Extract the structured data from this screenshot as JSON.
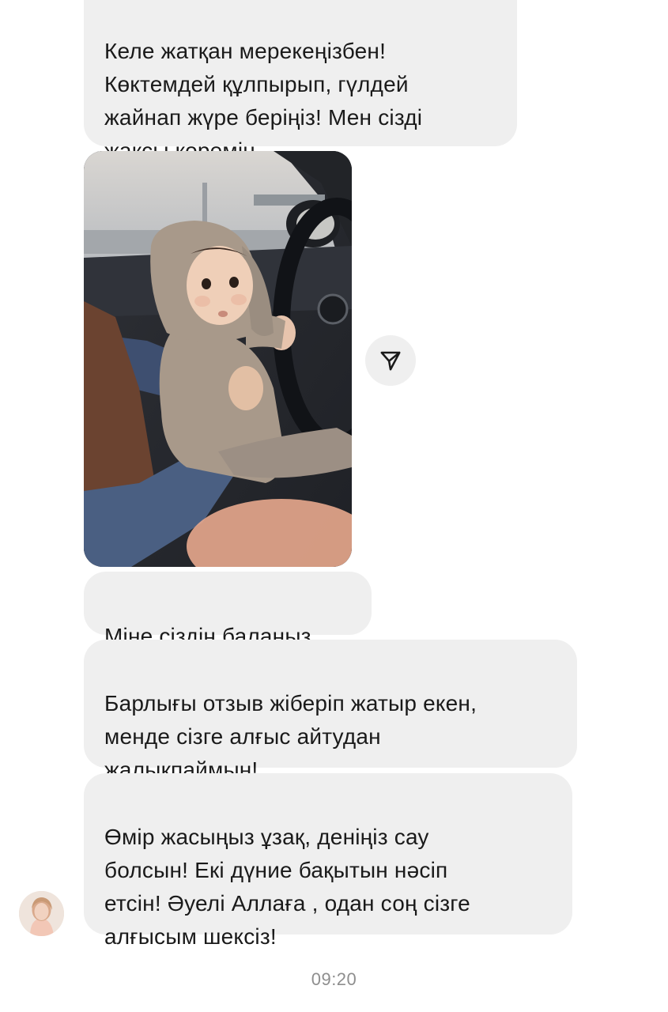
{
  "messages": [
    {
      "text": "Келе жатқан мерекеңізбен!\nКөктемдей құлпырып, гүлдей\nжайнап жүре беріңіз! Мен сізді\nжақсы көремін"
    },
    {
      "text": "Міне сіздің балаңыз"
    },
    {
      "text": "Барлығы отзыв жіберіп жатыр екен,\nменде сізге алғыс айтудан\nжалықпаймын!"
    },
    {
      "text": "Өмір жасыңыз ұзақ, деніңіз сау\nболсын!  Екі дүние бақытын нәсіп\nетсін!  Әуелі Аллаға , одан соң сізге\nалғысым шексіз!"
    }
  ],
  "photo": {
    "subject": "baby in hooded knit outfit in car"
  },
  "share_icon": "paper-plane-icon",
  "timestamp": "09:20",
  "colors": {
    "bubble_bg": "#efefef",
    "text": "#1a1a1a",
    "timestamp": "#8e8e8e",
    "page_bg": "#ffffff"
  }
}
